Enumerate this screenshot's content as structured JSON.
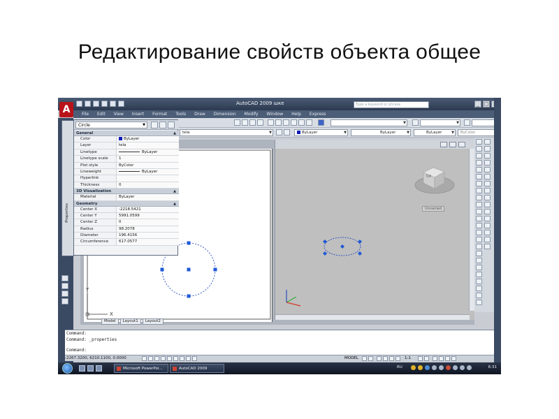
{
  "slide": {
    "title": "Редактирование свойств объекта общее"
  },
  "window": {
    "app_title": "AutoCAD 2009 шке",
    "search_placeholder": "Type a keyword or phrase"
  },
  "menu": [
    "File",
    "Edit",
    "View",
    "Insert",
    "Format",
    "Tools",
    "Draw",
    "Dimension",
    "Modify",
    "Window",
    "Help",
    "Express"
  ],
  "toolbar": {
    "layer_combo": "tela",
    "color_combo": "ByLayer",
    "linetype_combo": "ByLayer",
    "lineweight_combo": "ByLayer",
    "plotstyle_combo": "ByColor"
  },
  "properties": {
    "palette_label": "Properties",
    "object_type": "Circle",
    "sections": [
      {
        "name": "General",
        "rows": [
          {
            "key": "Color",
            "value": "ByLayer",
            "swatch": "#0a1ab8"
          },
          {
            "key": "Layer",
            "value": "tela"
          },
          {
            "key": "Linetype",
            "value": "ByLayer",
            "line": true
          },
          {
            "key": "Linetype scale",
            "value": "1"
          },
          {
            "key": "Plot style",
            "value": "ByColor"
          },
          {
            "key": "Lineweight",
            "value": "ByLayer",
            "line": true
          },
          {
            "key": "Hyperlink",
            "value": ""
          },
          {
            "key": "Thickness",
            "value": "0"
          }
        ]
      },
      {
        "name": "3D Visualization",
        "rows": [
          {
            "key": "Material",
            "value": "ByLayer"
          }
        ]
      },
      {
        "name": "Geometry",
        "rows": [
          {
            "key": "Center X",
            "value": "-2218.5421"
          },
          {
            "key": "Center Y",
            "value": "5991.0599"
          },
          {
            "key": "Center Z",
            "value": "0"
          },
          {
            "key": "Radius",
            "value": "98.2078"
          },
          {
            "key": "Diameter",
            "value": "196.4156"
          },
          {
            "key": "Circumference",
            "value": "617.0577"
          }
        ]
      }
    ]
  },
  "layout": {
    "tabs": [
      "Model",
      "Layout1",
      "Layout2"
    ],
    "ucs_x": "X",
    "ucs_y": "Y",
    "viewcube_label": "TOP",
    "unnamed_label": "Unnamed"
  },
  "command": {
    "lines": [
      "Command:",
      "Command: _properties",
      "Command:"
    ]
  },
  "status": {
    "coords": "-2267.3200, 6210.1100, 0.0000",
    "model": "MODEL",
    "scale": "1:1",
    "time": "6:31",
    "lang": "RU"
  },
  "taskbar": {
    "items": [
      "Microsoft PowerPoi...",
      "AutoCAD 2009"
    ]
  },
  "colors": {
    "selection_blue": "#1f5ad6",
    "circle_blue": "#2a4dbf",
    "autocad_red": "#b9131a"
  }
}
